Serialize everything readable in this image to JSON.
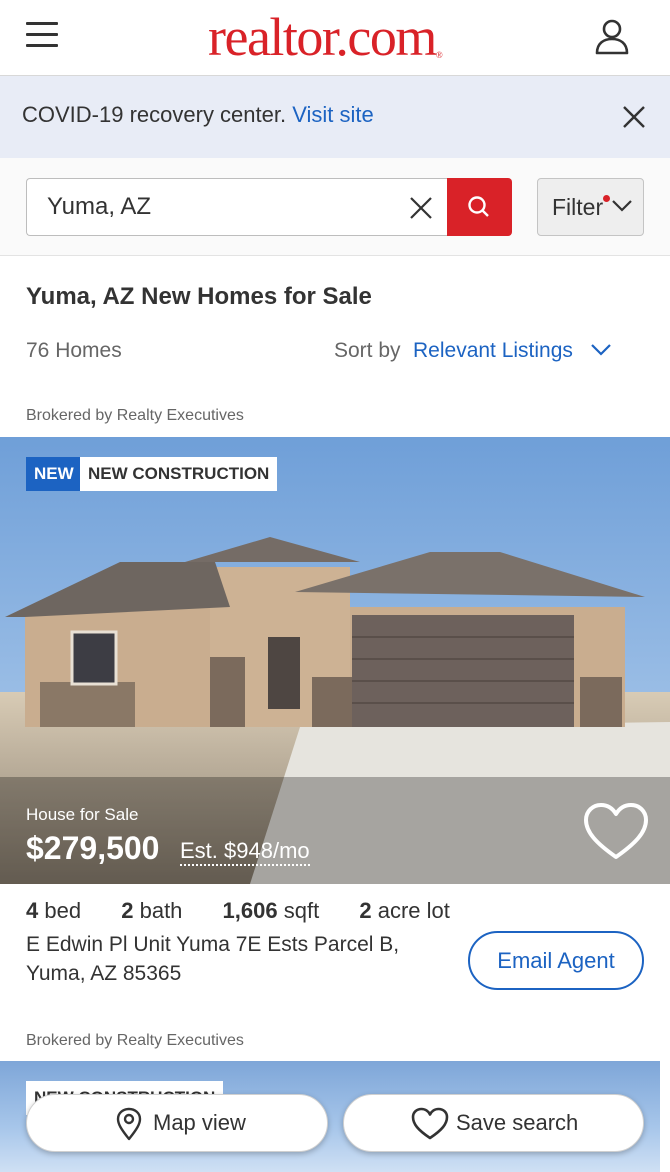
{
  "header": {
    "logo_text": "realtor.com",
    "logo_mark": "®"
  },
  "banner": {
    "text": "COVID-19 recovery center.",
    "link": "Visit site"
  },
  "search": {
    "value": "Yuma, AZ",
    "filter_label": "Filter"
  },
  "results": {
    "title": "Yuma, AZ New Homes for Sale",
    "count": "76 Homes",
    "sort_label": "Sort by",
    "sort_value": "Relevant Listings"
  },
  "listings": [
    {
      "brokered": "Brokered by Realty Executives",
      "badge_new": "NEW",
      "badge_type": "NEW CONSTRUCTION",
      "property_type": "House for Sale",
      "price": "$279,500",
      "estimate": "Est. $948/mo",
      "beds": "4",
      "beds_label": "bed",
      "baths": "2",
      "baths_label": "bath",
      "sqft": "1,606",
      "sqft_label": "sqft",
      "lot": "2",
      "lot_label": "acre lot",
      "address_line1": "E Edwin Pl Unit Yuma 7E Ests Parcel B,",
      "address_line2": "Yuma, AZ 85365",
      "email_label": "Email Agent"
    },
    {
      "brokered": "Brokered by Realty Executives",
      "badge_type": "NEW CONSTRUCTION"
    }
  ],
  "bottom": {
    "map_label": "Map view",
    "save_label": "Save search"
  },
  "colors": {
    "brand_red": "#d92228",
    "link_blue": "#1c63c2",
    "banner_bg": "#e8ecf6"
  },
  "icons": [
    "menu-icon",
    "profile-icon",
    "close-icon",
    "clear-icon",
    "search-icon",
    "chevron-down-icon",
    "heart-icon",
    "map-pin-icon"
  ]
}
